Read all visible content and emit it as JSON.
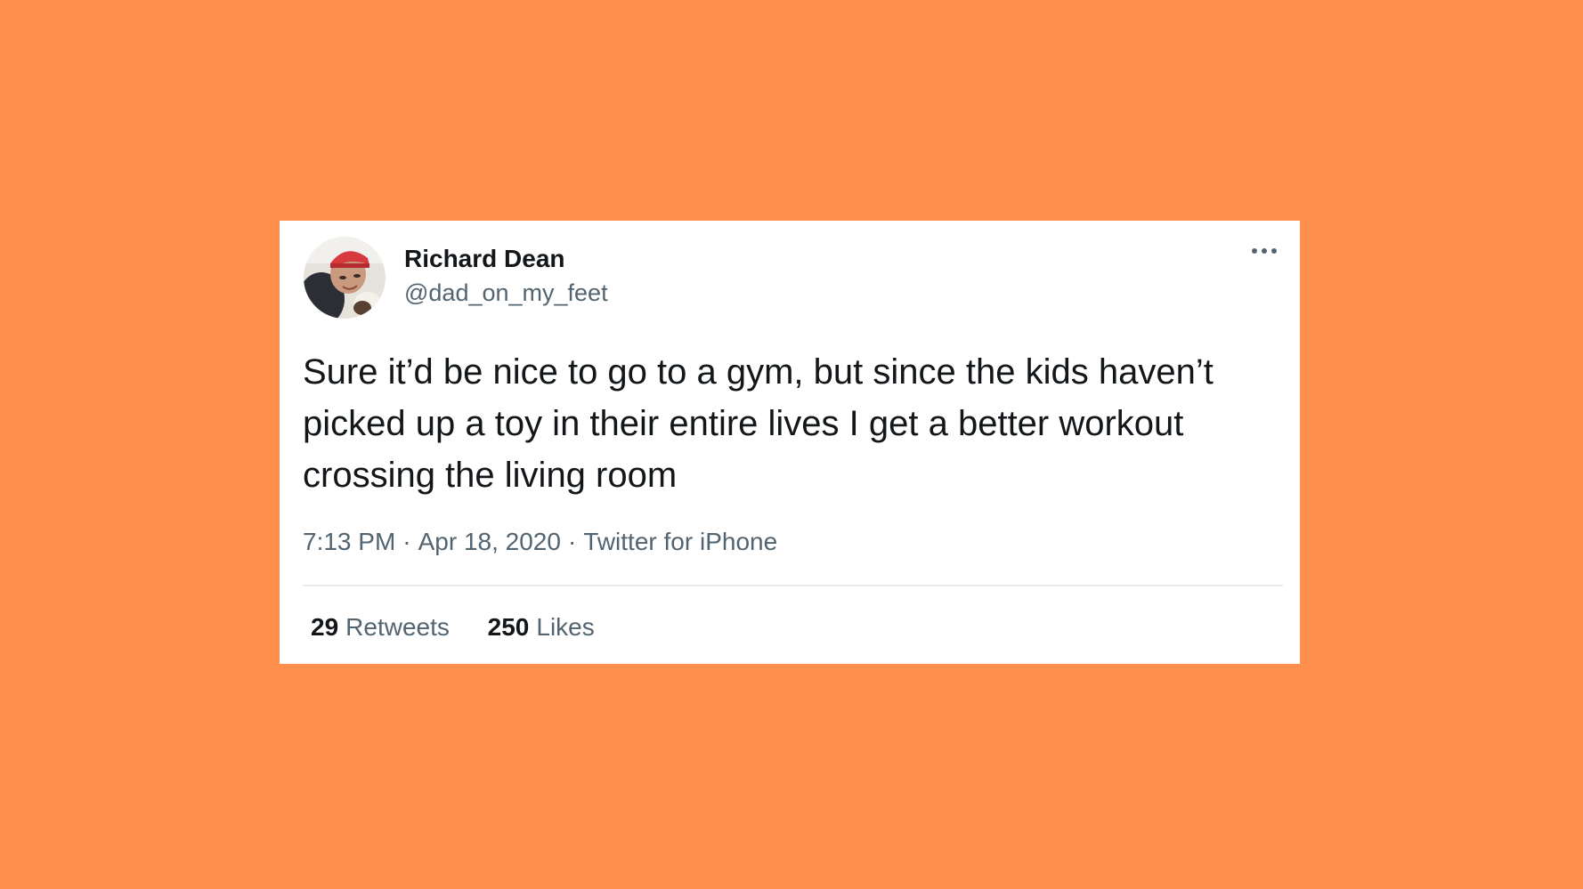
{
  "background_color": "#ff8f4d",
  "tweet": {
    "author": {
      "display_name": "Richard Dean",
      "handle": "@dad_on_my_feet",
      "avatar_icon": "user-avatar-photo"
    },
    "more_icon": "more-horizontal-icon",
    "text": "Sure it’d be nice to go to a gym, but since the kids haven’t picked up a toy in their entire lives I get a better workout crossing the living room",
    "time": "7:13 PM",
    "date": "Apr 18, 2020",
    "source": "Twitter for iPhone",
    "separator": "·",
    "retweets": {
      "count": "29",
      "label": "Retweets"
    },
    "likes": {
      "count": "250",
      "label": "Likes"
    }
  }
}
